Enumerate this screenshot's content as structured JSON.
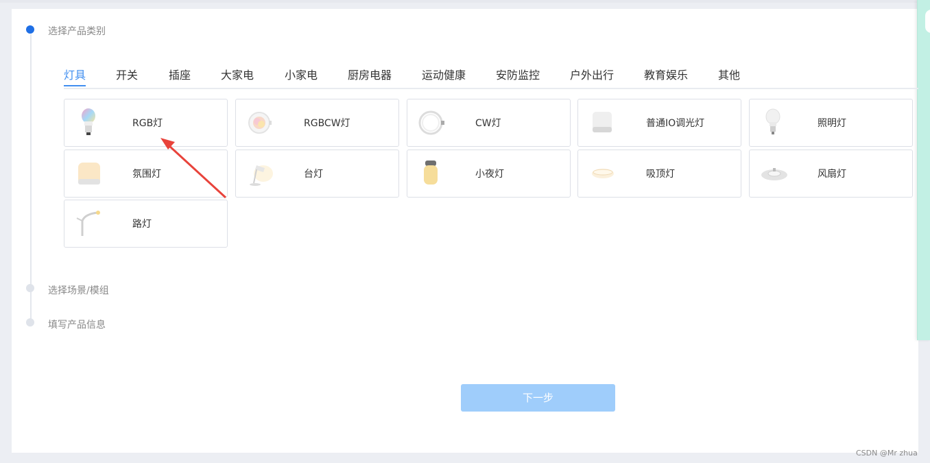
{
  "steps": [
    {
      "label": "选择产品类别",
      "state": "active"
    },
    {
      "label": "选择场景/模组",
      "state": "pending"
    },
    {
      "label": "填写产品信息",
      "state": "pending"
    }
  ],
  "tabs": [
    {
      "label": "灯具",
      "active": true
    },
    {
      "label": "开关"
    },
    {
      "label": "插座"
    },
    {
      "label": "大家电"
    },
    {
      "label": "小家电"
    },
    {
      "label": "厨房电器"
    },
    {
      "label": "运动健康"
    },
    {
      "label": "安防监控"
    },
    {
      "label": "户外出行"
    },
    {
      "label": "教育娱乐"
    },
    {
      "label": "其他"
    }
  ],
  "products": [
    {
      "label": "RGB灯",
      "icon": "rgb-bulb-icon"
    },
    {
      "label": "RGBCW灯",
      "icon": "round-light-icon"
    },
    {
      "label": "CW灯",
      "icon": "ring-light-icon"
    },
    {
      "label": "普通IO调光灯",
      "icon": "cube-light-icon"
    },
    {
      "label": "照明灯",
      "icon": "bulb-icon"
    },
    {
      "label": "氛围灯",
      "icon": "ambient-light-icon"
    },
    {
      "label": "台灯",
      "icon": "desk-lamp-icon"
    },
    {
      "label": "小夜灯",
      "icon": "night-light-icon"
    },
    {
      "label": "吸顶灯",
      "icon": "ceiling-light-icon"
    },
    {
      "label": "风扇灯",
      "icon": "fan-light-icon"
    },
    {
      "label": "路灯",
      "icon": "street-light-icon"
    }
  ],
  "next_button": {
    "label": "下一步"
  },
  "watermark": "CSDN @Mr zhua",
  "colors": {
    "accent": "#3f8ef0",
    "step_active": "#1f6fe5",
    "button_disabled": "#9fcdfb",
    "annotation_arrow": "#e8433b"
  }
}
